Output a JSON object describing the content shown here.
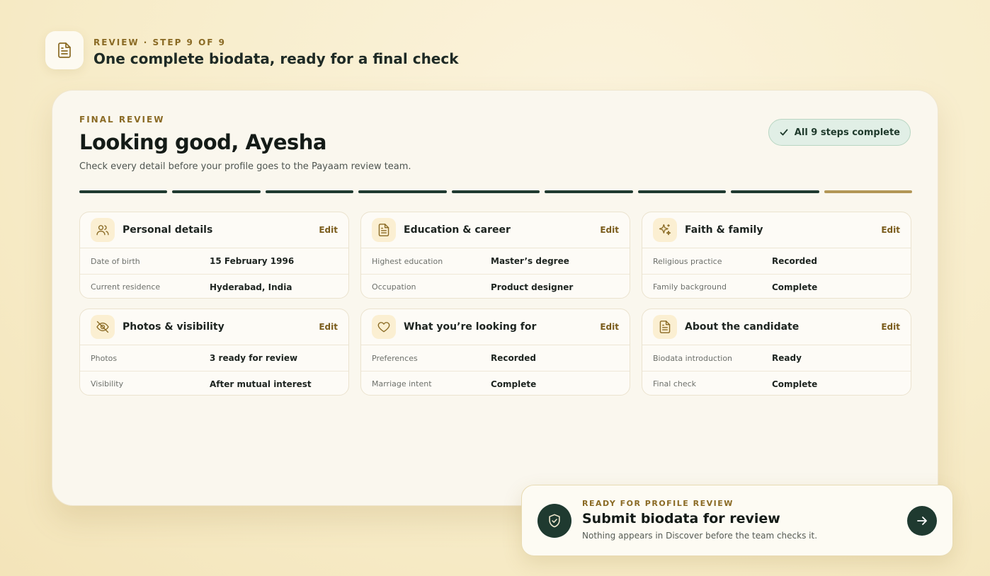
{
  "header": {
    "eyebrow": "REVIEW · STEP 9 OF 9",
    "title": "One complete biodata, ready for a final check",
    "icon": "document-icon"
  },
  "review": {
    "eyebrow": "FINAL REVIEW",
    "greeting": "Looking good, Ayesha",
    "subtitle": "Check every detail before your profile goes to the Payaam review team.",
    "status_pill": "All 9 steps complete",
    "progress": {
      "total_steps": 9,
      "completed_steps": 9,
      "current_step": 9
    }
  },
  "sections": [
    {
      "title": "Personal details",
      "icon": "users-icon",
      "edit_label": "Edit",
      "rows": [
        {
          "label": "Date of birth",
          "value": "15 February 1996"
        },
        {
          "label": "Current residence",
          "value": "Hyderabad, India"
        }
      ]
    },
    {
      "title": "Education & career",
      "icon": "document-icon",
      "edit_label": "Edit",
      "rows": [
        {
          "label": "Highest education",
          "value": "Master’s degree"
        },
        {
          "label": "Occupation",
          "value": "Product designer"
        }
      ]
    },
    {
      "title": "Faith & family",
      "icon": "sparkles-icon",
      "edit_label": "Edit",
      "rows": [
        {
          "label": "Religious practice",
          "value": "Recorded"
        },
        {
          "label": "Family background",
          "value": "Complete"
        }
      ]
    },
    {
      "title": "Photos & visibility",
      "icon": "eye-off-icon",
      "edit_label": "Edit",
      "rows": [
        {
          "label": "Photos",
          "value": "3 ready for review"
        },
        {
          "label": "Visibility",
          "value": "After mutual interest"
        }
      ]
    },
    {
      "title": "What you’re looking for",
      "icon": "heart-icon",
      "edit_label": "Edit",
      "rows": [
        {
          "label": "Preferences",
          "value": "Recorded"
        },
        {
          "label": "Marriage intent",
          "value": "Complete"
        }
      ]
    },
    {
      "title": "About the candidate",
      "icon": "document-icon",
      "edit_label": "Edit",
      "rows": [
        {
          "label": "Biodata introduction",
          "value": "Ready"
        },
        {
          "label": "Final check",
          "value": "Complete"
        }
      ]
    }
  ],
  "submit": {
    "eyebrow": "READY FOR PROFILE REVIEW",
    "title": "Submit biodata for review",
    "note": "Nothing appears in Discover before the team checks it.",
    "icon": "shield-check-icon",
    "action_icon": "arrow-right-icon"
  },
  "colors": {
    "accent_dark": "#1f3a30",
    "accent_gold": "#8a6a24",
    "progress_current": "#b29656",
    "icon_bg": "#fbefd2"
  }
}
